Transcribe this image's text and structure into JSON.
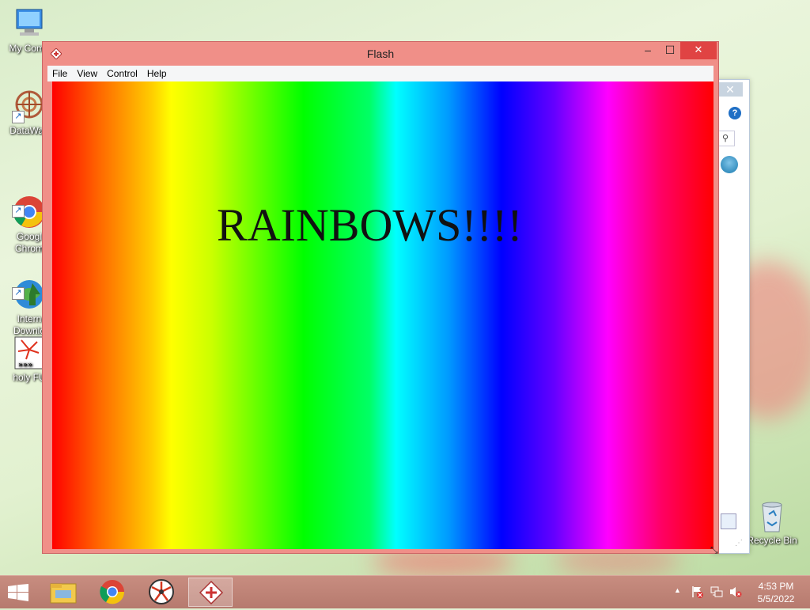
{
  "desktop": {
    "icons": [
      {
        "label": "My Comp",
        "icon": "computer-icon"
      },
      {
        "label": "DataWag",
        "icon": "datawagon-icon"
      },
      {
        "label": "Googl\nChrom",
        "icon": "chrome-icon"
      },
      {
        "label": "Intern\nDownlo",
        "icon": "internet-download-manager-icon"
      },
      {
        "label": "holy FU",
        "icon": "video-file-icon"
      },
      {
        "label": "Recycle Bin",
        "icon": "recycle-bin-icon"
      }
    ]
  },
  "background_window": {
    "close_glyph": "✕",
    "help_glyph": "?",
    "search_glyph": "⚲"
  },
  "flash_window": {
    "title": "Flash",
    "controls": {
      "minimize": "–",
      "maximize": "☐",
      "close": "✕"
    },
    "menu": [
      "File",
      "View",
      "Control",
      "Help"
    ],
    "stage_text": "RAINBOWS!!!!"
  },
  "taskbar": {
    "pinned": [
      {
        "name": "file-explorer",
        "icon": "folder-icon"
      },
      {
        "name": "chrome",
        "icon": "chrome-icon"
      },
      {
        "name": "flash-app",
        "icon": "flash-icon"
      },
      {
        "name": "flash-window",
        "icon": "flash-player-icon",
        "active": true
      }
    ],
    "tray_arrow": "▲",
    "clock": {
      "time": "4:53 PM",
      "date": "5/5/2022"
    }
  },
  "colors": {
    "flash_frame": "#f08f88",
    "taskbar": "#c08478",
    "close_button": "#e04343"
  }
}
